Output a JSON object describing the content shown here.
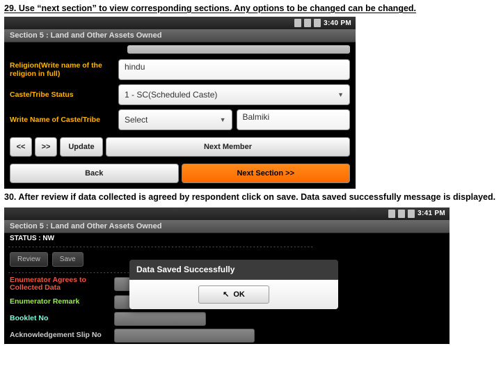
{
  "step29": "29. Use “next section” to view corresponding sections. Any options to be changed can be changed.",
  "step30": "30. After review if data collected is agreed by respondent click on save. Data saved successfully message is displayed.",
  "status": {
    "time1": "3:40 PM",
    "time2": "3:41 PM"
  },
  "screen1": {
    "section_title": "Section 5  : Land and Other Assets Owned",
    "label_religion": "Religion(Write name of the religion in full)",
    "religion_value": "hindu",
    "label_caste_status": "Caste/Tribe Status",
    "caste_status_value": "1 - SC(Scheduled Caste)",
    "label_caste_name": "Write Name of Caste/Tribe",
    "caste_select": "Select",
    "caste_text": "Balmiki",
    "btn_prev": "<<",
    "btn_next": ">>",
    "btn_update": "Update",
    "btn_next_member": "Next Member",
    "btn_back": "Back",
    "btn_next_section": "Next Section >>"
  },
  "screen2": {
    "section_title": "Section 5  : Land and Other Assets Owned",
    "status_nw": "STATUS : NW",
    "btn_review": "Review",
    "btn_save": "Save",
    "label_enum_agrees": "Enumerator Agrees to Collected Data",
    "label_enum_remark": "Enumerator Remark",
    "label_booklet": "Booklet No",
    "label_ack": "Acknowledgement Slip No",
    "dialog_title": "Data Saved Successfully",
    "dialog_ok": "OK"
  }
}
